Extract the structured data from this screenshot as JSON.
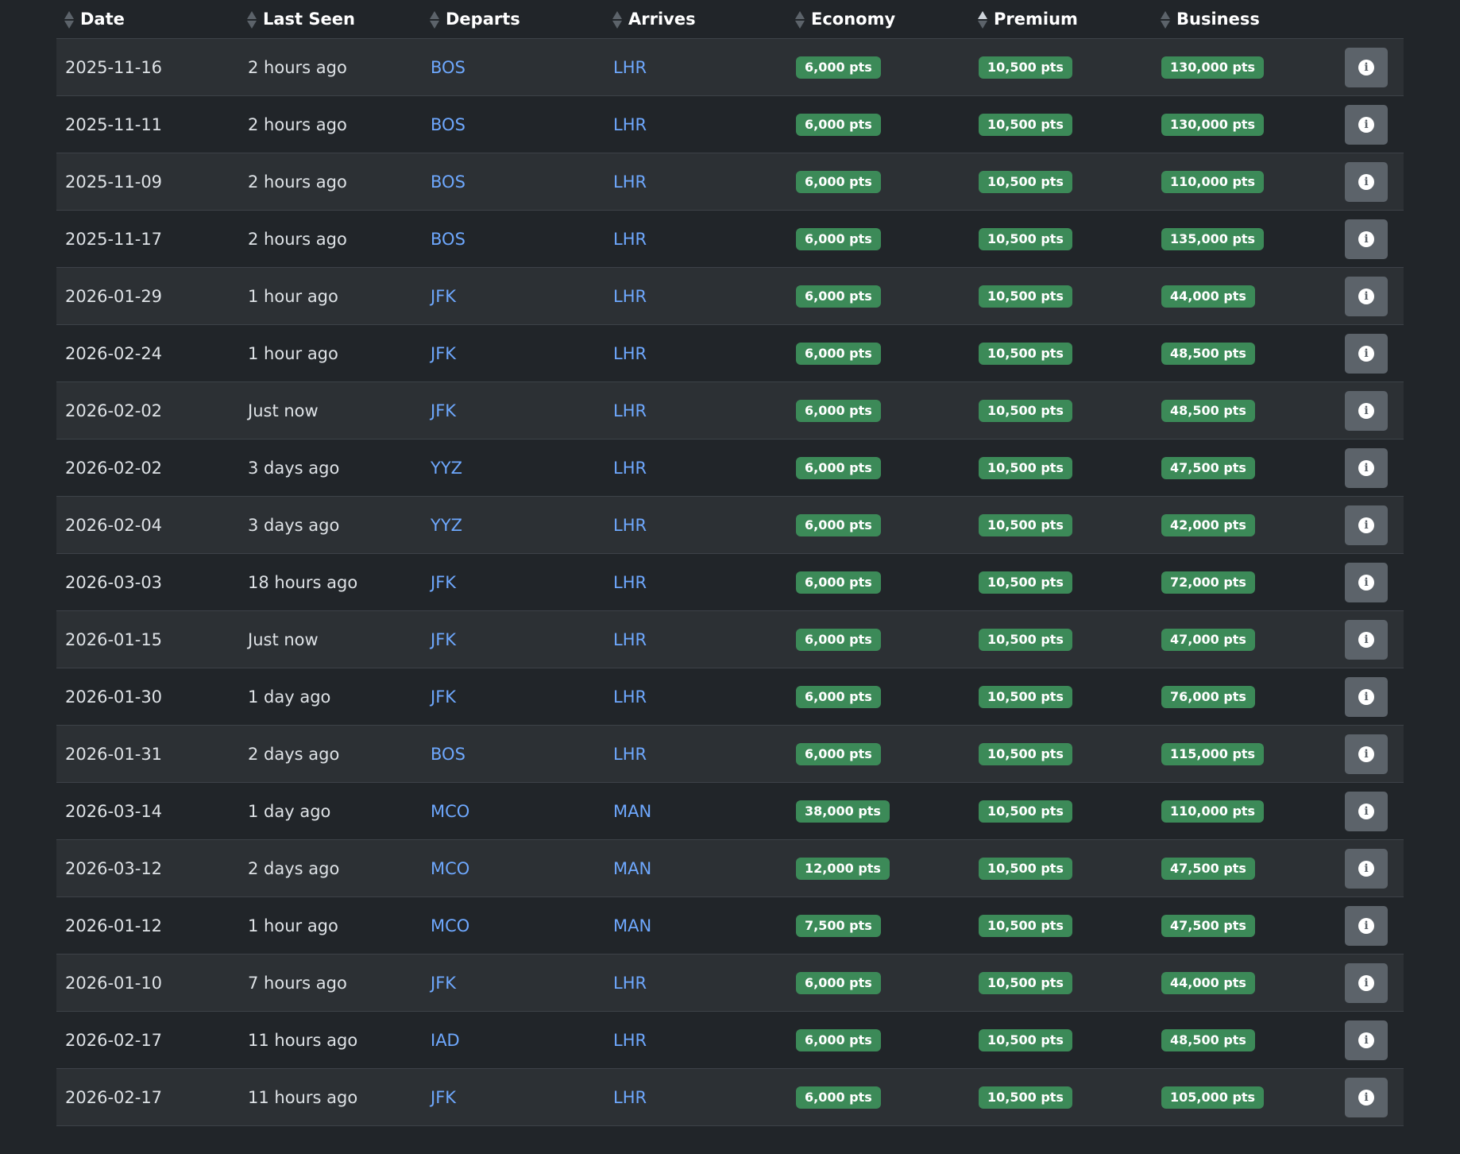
{
  "table": {
    "columns": [
      {
        "label": "Date",
        "sort": "none"
      },
      {
        "label": "Last Seen",
        "sort": "none"
      },
      {
        "label": "Departs",
        "sort": "none"
      },
      {
        "label": "Arrives",
        "sort": "none"
      },
      {
        "label": "Economy",
        "sort": "none"
      },
      {
        "label": "Premium",
        "sort": "asc"
      },
      {
        "label": "Business",
        "sort": "none"
      }
    ],
    "info_icon": "info-circle-icon",
    "rows": [
      {
        "date": "2025-11-16",
        "seen": "2 hours ago",
        "from": "BOS",
        "to": "LHR",
        "eco": "6,000 pts",
        "prem": "10,500 pts",
        "bus": "130,000 pts"
      },
      {
        "date": "2025-11-11",
        "seen": "2 hours ago",
        "from": "BOS",
        "to": "LHR",
        "eco": "6,000 pts",
        "prem": "10,500 pts",
        "bus": "130,000 pts"
      },
      {
        "date": "2025-11-09",
        "seen": "2 hours ago",
        "from": "BOS",
        "to": "LHR",
        "eco": "6,000 pts",
        "prem": "10,500 pts",
        "bus": "110,000 pts"
      },
      {
        "date": "2025-11-17",
        "seen": "2 hours ago",
        "from": "BOS",
        "to": "LHR",
        "eco": "6,000 pts",
        "prem": "10,500 pts",
        "bus": "135,000 pts"
      },
      {
        "date": "2026-01-29",
        "seen": "1 hour ago",
        "from": "JFK",
        "to": "LHR",
        "eco": "6,000 pts",
        "prem": "10,500 pts",
        "bus": "44,000 pts"
      },
      {
        "date": "2026-02-24",
        "seen": "1 hour ago",
        "from": "JFK",
        "to": "LHR",
        "eco": "6,000 pts",
        "prem": "10,500 pts",
        "bus": "48,500 pts"
      },
      {
        "date": "2026-02-02",
        "seen": "Just now",
        "from": "JFK",
        "to": "LHR",
        "eco": "6,000 pts",
        "prem": "10,500 pts",
        "bus": "48,500 pts"
      },
      {
        "date": "2026-02-02",
        "seen": "3 days ago",
        "from": "YYZ",
        "to": "LHR",
        "eco": "6,000 pts",
        "prem": "10,500 pts",
        "bus": "47,500 pts"
      },
      {
        "date": "2026-02-04",
        "seen": "3 days ago",
        "from": "YYZ",
        "to": "LHR",
        "eco": "6,000 pts",
        "prem": "10,500 pts",
        "bus": "42,000 pts"
      },
      {
        "date": "2026-03-03",
        "seen": "18 hours ago",
        "from": "JFK",
        "to": "LHR",
        "eco": "6,000 pts",
        "prem": "10,500 pts",
        "bus": "72,000 pts"
      },
      {
        "date": "2026-01-15",
        "seen": "Just now",
        "from": "JFK",
        "to": "LHR",
        "eco": "6,000 pts",
        "prem": "10,500 pts",
        "bus": "47,000 pts"
      },
      {
        "date": "2026-01-30",
        "seen": "1 day ago",
        "from": "JFK",
        "to": "LHR",
        "eco": "6,000 pts",
        "prem": "10,500 pts",
        "bus": "76,000 pts"
      },
      {
        "date": "2026-01-31",
        "seen": "2 days ago",
        "from": "BOS",
        "to": "LHR",
        "eco": "6,000 pts",
        "prem": "10,500 pts",
        "bus": "115,000 pts"
      },
      {
        "date": "2026-03-14",
        "seen": "1 day ago",
        "from": "MCO",
        "to": "MAN",
        "eco": "38,000 pts",
        "prem": "10,500 pts",
        "bus": "110,000 pts"
      },
      {
        "date": "2026-03-12",
        "seen": "2 days ago",
        "from": "MCO",
        "to": "MAN",
        "eco": "12,000 pts",
        "prem": "10,500 pts",
        "bus": "47,500 pts"
      },
      {
        "date": "2026-01-12",
        "seen": "1 hour ago",
        "from": "MCO",
        "to": "MAN",
        "eco": "7,500 pts",
        "prem": "10,500 pts",
        "bus": "47,500 pts"
      },
      {
        "date": "2026-01-10",
        "seen": "7 hours ago",
        "from": "JFK",
        "to": "LHR",
        "eco": "6,000 pts",
        "prem": "10,500 pts",
        "bus": "44,000 pts"
      },
      {
        "date": "2026-02-17",
        "seen": "11 hours ago",
        "from": "IAD",
        "to": "LHR",
        "eco": "6,000 pts",
        "prem": "10,500 pts",
        "bus": "48,500 pts"
      },
      {
        "date": "2026-02-17",
        "seen": "11 hours ago",
        "from": "JFK",
        "to": "LHR",
        "eco": "6,000 pts",
        "prem": "10,500 pts",
        "bus": "105,000 pts"
      }
    ]
  },
  "colors": {
    "background": "#212529",
    "row_alt": "#2c3034",
    "link": "#6ea8fe",
    "pill": "#3c8a58",
    "button": "#5c636a"
  }
}
